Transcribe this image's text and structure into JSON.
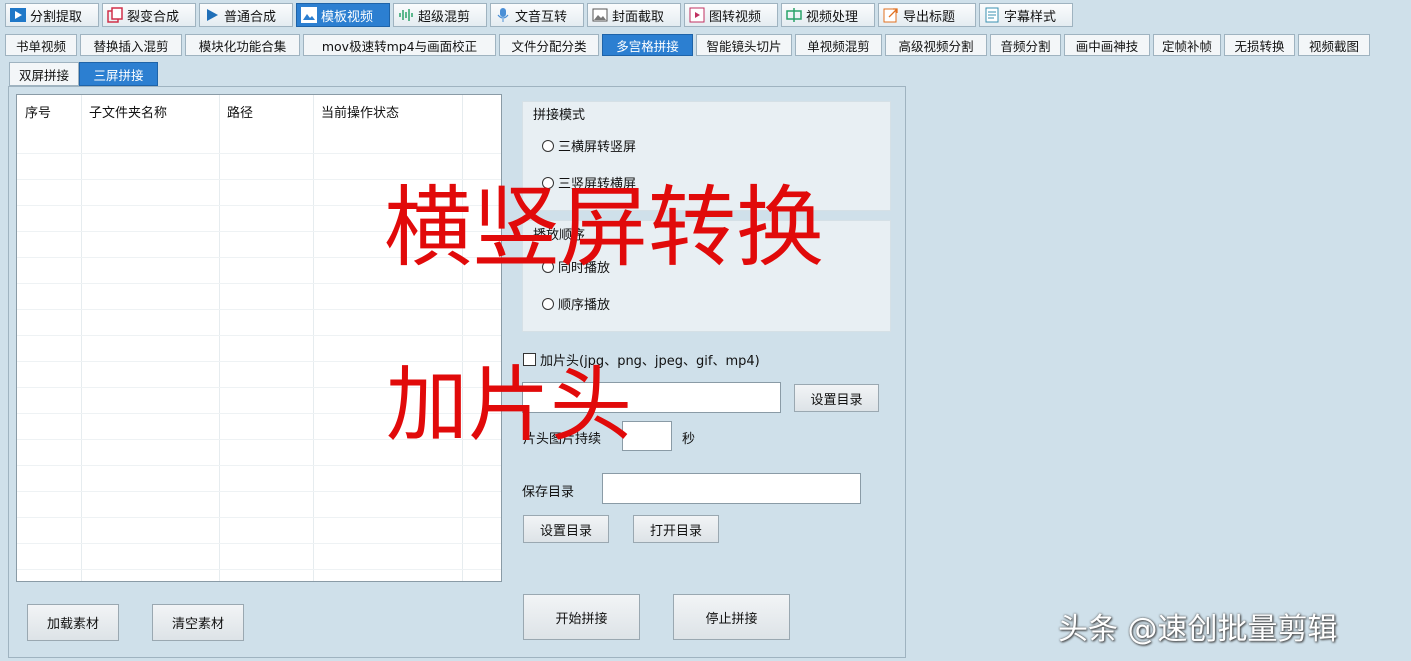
{
  "toolbar": {
    "items": [
      {
        "label": "分割提取",
        "icon": "play-icon"
      },
      {
        "label": "裂变合成",
        "icon": "copy-icon"
      },
      {
        "label": "普通合成",
        "icon": "triangle-icon"
      },
      {
        "label": "模板视频",
        "icon": "image-icon"
      },
      {
        "label": "超级混剪",
        "icon": "waveform-icon"
      },
      {
        "label": "文音互转",
        "icon": "microphone-icon"
      },
      {
        "label": "封面截取",
        "icon": "picture-icon"
      },
      {
        "label": "图转视频",
        "icon": "frame-icon"
      },
      {
        "label": "视频处理",
        "icon": "process-icon"
      },
      {
        "label": "导出标题",
        "icon": "export-icon"
      },
      {
        "label": "字幕样式",
        "icon": "document-icon"
      }
    ],
    "active_index": 3
  },
  "tabs2": [
    "书单视频",
    "替换插入混剪",
    "模块化功能合集",
    "mov极速转mp4与画面校正",
    "文件分配分类",
    "多宫格拼接",
    "智能镜头切片",
    "单视频混剪",
    "高级视频分割",
    "音频分割",
    "画中画神技",
    "定帧补帧",
    "无损转换",
    "视频截图"
  ],
  "tabs2_active": 5,
  "tabs3": [
    "双屏拼接",
    "三屏拼接"
  ],
  "tabs3_active": 1,
  "list": {
    "headers": [
      "序号",
      "子文件夹名称",
      "路径",
      "当前操作状态"
    ]
  },
  "left_buttons": {
    "load": "加载素材",
    "clear": "清空素材"
  },
  "mode_group": {
    "title": "拼接模式",
    "options": [
      "三横屏转竖屏",
      "三竖屏转横屏"
    ]
  },
  "order_group": {
    "title": "播放顺序",
    "options": [
      "同时播放",
      "顺序播放"
    ]
  },
  "intro": {
    "checkbox_label": "加片头(jpg、png、jpeg、gif、mp4)",
    "set_dir": "设置目录",
    "duration_label": "片头图片持续",
    "duration_unit": "秒"
  },
  "save": {
    "label": "保存目录",
    "set_dir": "设置目录",
    "open_dir": "打开目录"
  },
  "actions": {
    "start": "开始拼接",
    "stop": "停止拼接"
  },
  "overlay": {
    "line1": "横竖屏转换",
    "line2": "加片头"
  },
  "watermark": "头条 @速创批量剪辑",
  "colors": {
    "accent": "#2c7fd1",
    "overlay": "#e10a0a",
    "background": "#cfe0ea"
  }
}
